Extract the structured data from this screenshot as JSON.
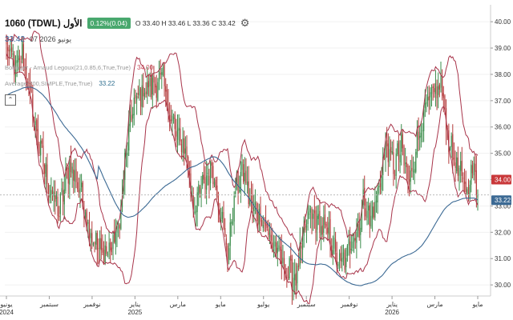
{
  "header": {
    "title": "1060 (TDWL) الأول",
    "change": "0.12%(0.04)",
    "ohlc": "O 33.40  H 33.46  L 33.36  C 33.42",
    "price": "33.42",
    "date": "07 يونيو 2026"
  },
  "indicators": [
    {
      "label": "Bollinger - Arnaud Legoux(21,0.85,6,True,True)",
      "value": "34.00"
    },
    {
      "label": "Average(200,SIMPLE,True,True)",
      "value": "33.22"
    }
  ],
  "colors": {
    "up": "#3a8c4a",
    "down": "#b43a3a",
    "band": "#a8344a",
    "ma": "#3c6a94",
    "last_price_badge": "#c9383a",
    "ma_badge": "#3c6a94",
    "close_line": "#bbbbbb"
  },
  "chart_data": {
    "type": "candlestick",
    "price_axis": [
      "40.00",
      "39.00",
      "38.00",
      "37.00",
      "36.00",
      "35.00",
      "34.00",
      "33.00",
      "32.00",
      "31.00",
      "30.00"
    ],
    "ylim": [
      29.7,
      40.4
    ],
    "x_labels": [
      {
        "label": "يونيو",
        "sub": "2024"
      },
      {
        "label": "سبتمبر",
        "sub": ""
      },
      {
        "label": "نوفمبر",
        "sub": ""
      },
      {
        "label": "يناير",
        "sub": "2025"
      },
      {
        "label": "مارس",
        "sub": ""
      },
      {
        "label": "مايو",
        "sub": ""
      },
      {
        "label": "يوليو",
        "sub": ""
      },
      {
        "label": "سبتمبر",
        "sub": ""
      },
      {
        "label": "نوفمبر",
        "sub": ""
      },
      {
        "label": "يناير",
        "sub": "2026"
      },
      {
        "label": "مارس",
        "sub": ""
      },
      {
        "label": "مايو",
        "sub": ""
      }
    ],
    "anchors": [
      [
        0,
        39.0
      ],
      [
        8,
        38.2
      ],
      [
        12,
        38.8
      ],
      [
        18,
        37.2
      ],
      [
        24,
        35.5
      ],
      [
        32,
        33.8
      ],
      [
        40,
        32.8
      ],
      [
        48,
        34.6
      ],
      [
        56,
        33.6
      ],
      [
        64,
        32.0
      ],
      [
        72,
        31.2
      ],
      [
        80,
        31.4
      ],
      [
        86,
        32.4
      ],
      [
        90,
        34.6
      ],
      [
        96,
        36.8
      ],
      [
        104,
        37.4
      ],
      [
        112,
        37.6
      ],
      [
        118,
        37.9
      ],
      [
        124,
        36.5
      ],
      [
        130,
        35.6
      ],
      [
        136,
        35.2
      ],
      [
        142,
        33.0
      ],
      [
        148,
        33.6
      ],
      [
        156,
        34.5
      ],
      [
        162,
        33.0
      ],
      [
        168,
        31.2
      ],
      [
        174,
        33.6
      ],
      [
        180,
        34.3
      ],
      [
        186,
        33.0
      ],
      [
        194,
        32.6
      ],
      [
        200,
        31.8
      ],
      [
        206,
        31.2
      ],
      [
        214,
        30.5
      ],
      [
        220,
        30.3
      ],
      [
        226,
        31.8
      ],
      [
        230,
        32.7
      ],
      [
        238,
        32.3
      ],
      [
        246,
        31.8
      ],
      [
        252,
        30.8
      ],
      [
        258,
        30.9
      ],
      [
        262,
        31.8
      ],
      [
        268,
        32.2
      ],
      [
        272,
        33.4
      ],
      [
        276,
        32.4
      ],
      [
        282,
        33.4
      ],
      [
        288,
        35.3
      ],
      [
        294,
        34.5
      ],
      [
        300,
        35.2
      ],
      [
        306,
        33.8
      ],
      [
        312,
        35.5
      ],
      [
        318,
        36.6
      ],
      [
        324,
        37.2
      ],
      [
        330,
        37.6
      ],
      [
        336,
        35.5
      ],
      [
        342,
        34.5
      ],
      [
        346,
        34.0
      ],
      [
        350,
        33.6
      ],
      [
        354,
        34.5
      ],
      [
        358,
        33.5
      ]
    ],
    "last_close": 33.42,
    "badges": [
      {
        "name": "close",
        "value": "34.00",
        "price": 34.0
      },
      {
        "name": "ma200",
        "value": "33.22",
        "price": 33.22
      }
    ]
  }
}
